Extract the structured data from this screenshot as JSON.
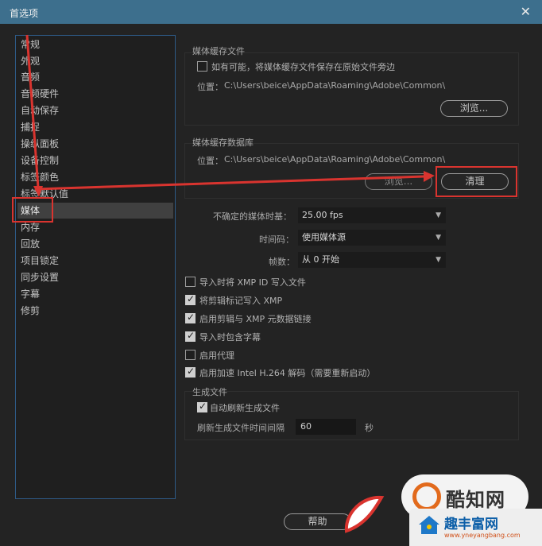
{
  "window": {
    "title": "首选项",
    "close_glyph": "✕"
  },
  "sidebar": {
    "items": [
      {
        "label": "常规"
      },
      {
        "label": "外观"
      },
      {
        "label": "音频"
      },
      {
        "label": "音频硬件"
      },
      {
        "label": "自动保存"
      },
      {
        "label": "捕捉"
      },
      {
        "label": "操纵面板"
      },
      {
        "label": "设备控制"
      },
      {
        "label": "标签颜色"
      },
      {
        "label": "标签默认值"
      },
      {
        "label": "媒体",
        "selected": true
      },
      {
        "label": "内存"
      },
      {
        "label": "回放"
      },
      {
        "label": "项目锁定"
      },
      {
        "label": "同步设置"
      },
      {
        "label": "字幕"
      },
      {
        "label": "修剪"
      }
    ]
  },
  "media_cache_files": {
    "title": "媒体缓存文件",
    "checkbox_label": "如有可能，将媒体缓存文件保存在原始文件旁边",
    "checked": false,
    "location_label": "位置：",
    "location_path": "C:\\Users\\beice\\AppData\\Roaming\\Adobe\\Common\\",
    "browse_label": "浏览..."
  },
  "media_cache_db": {
    "title": "媒体缓存数据库",
    "location_label": "位置：",
    "location_path": "C:\\Users\\beice\\AppData\\Roaming\\Adobe\\Common\\",
    "browse_label": "浏览...",
    "clean_label": "清理"
  },
  "settings": {
    "timebase_label": "不确定的媒体时基：",
    "timebase_value": "25.00 fps",
    "timecode_label": "时间码：",
    "timecode_value": "使用媒体源",
    "frame_label": "帧数：",
    "frame_value": "从 0 开始"
  },
  "options": [
    {
      "label": "导入时将 XMP ID 写入文件",
      "checked": false
    },
    {
      "label": "将剪辑标记写入 XMP",
      "checked": true
    },
    {
      "label": "启用剪辑与 XMP 元数据链接",
      "checked": true
    },
    {
      "label": "导入时包含字幕",
      "checked": true
    },
    {
      "label": "启用代理",
      "checked": false
    },
    {
      "label": "启用加速 Intel H.264 解码（需要重新启动）",
      "checked": true
    }
  ],
  "generate_files": {
    "title": "生成文件",
    "auto_refresh_label": "自动刷新生成文件",
    "auto_refresh_checked": true,
    "interval_label": "刷新生成文件时间间隔",
    "interval_value": "60",
    "interval_unit": "秒"
  },
  "footer": {
    "help_label": "帮助"
  },
  "watermark": {
    "logo_text": "酷知网",
    "site_name": "趣丰富网",
    "site_url": "www.yneyangbang.com"
  },
  "annotation_color": "#d9342f"
}
